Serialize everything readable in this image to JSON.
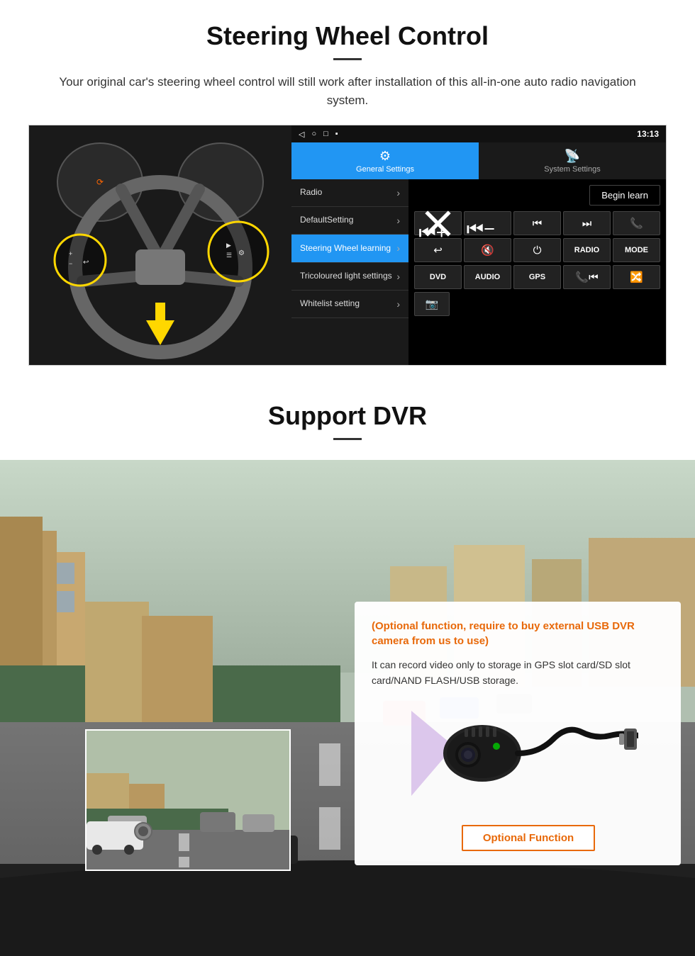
{
  "steering": {
    "title": "Steering Wheel Control",
    "description": "Your original car's steering wheel control will still work after installation of this all-in-one auto radio navigation system.",
    "divider": "—",
    "statusbar": {
      "icons": "◁  ○  □  ▪",
      "time": "13:13",
      "wifi": "▾"
    },
    "tabs": {
      "general": "General Settings",
      "system": "System Settings",
      "general_icon": "⚙",
      "system_icon": "📡"
    },
    "menu": [
      {
        "label": "Radio",
        "active": false
      },
      {
        "label": "DefaultSetting",
        "active": false
      },
      {
        "label": "Steering Wheel learning",
        "active": true
      },
      {
        "label": "Tricoloured light settings",
        "active": false
      },
      {
        "label": "Whitelist setting",
        "active": false
      }
    ],
    "begin_learn": "Begin learn",
    "buttons_row1": [
      "⏮+",
      "⏮−",
      "⏮",
      "⏭",
      "📞"
    ],
    "buttons_row2": [
      "↩",
      "🔇",
      "⏻",
      "RADIO",
      "MODE"
    ],
    "buttons_row3": [
      "DVD",
      "AUDIO",
      "GPS",
      "📞⏮",
      "🔀⏭"
    ],
    "buttons_row4": [
      "📷"
    ]
  },
  "dvr": {
    "title": "Support DVR",
    "divider": "—",
    "optional_text": "(Optional function, require to buy external USB DVR camera from us to use)",
    "description": "It can record video only to storage in GPS slot card/SD slot card/NAND FLASH/USB storage.",
    "optional_btn": "Optional Function"
  }
}
